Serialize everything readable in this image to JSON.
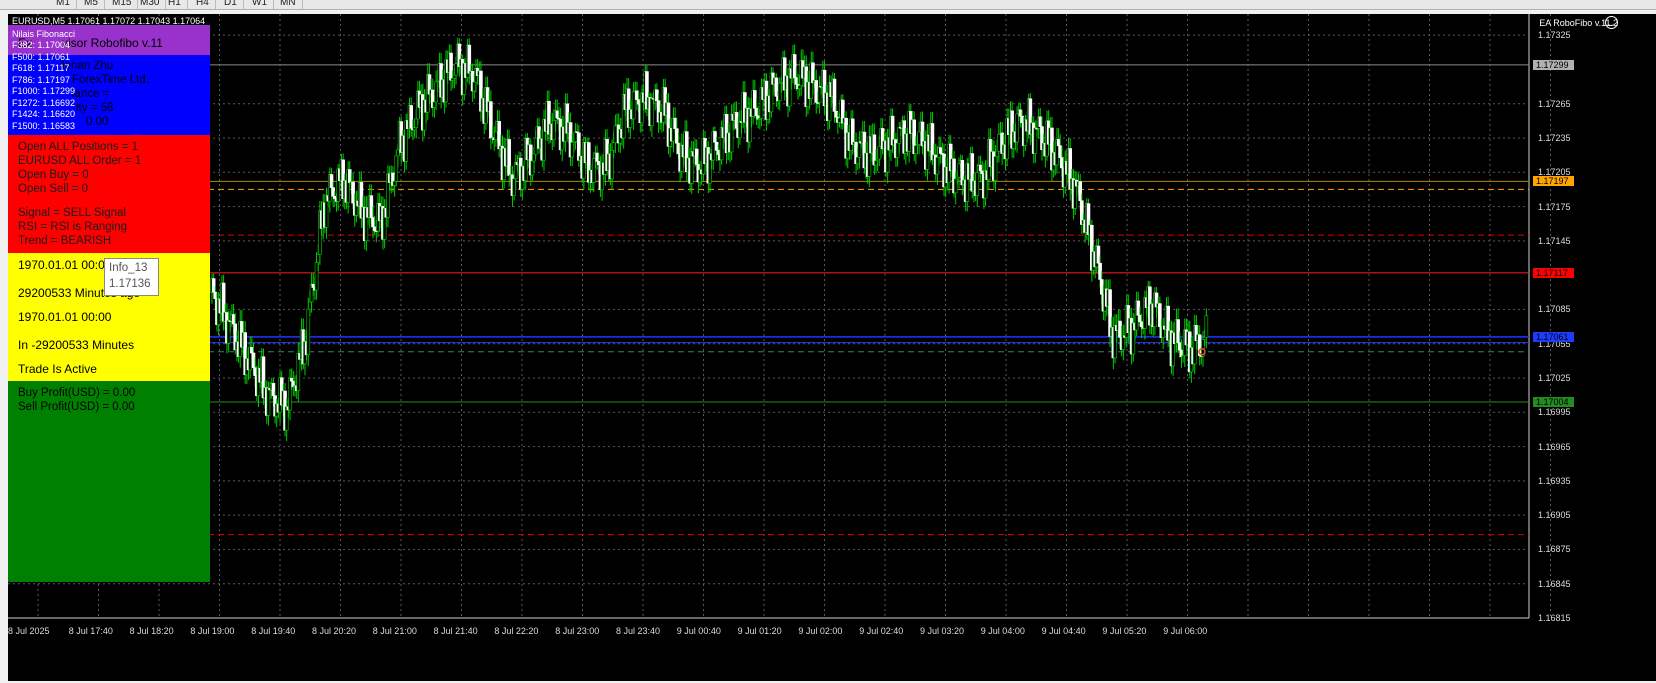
{
  "toolbar": {
    "timeframes": [
      "M1",
      "M5",
      "M15",
      "M30",
      "H1",
      "H4",
      "D1",
      "W1",
      "MN"
    ]
  },
  "chart": {
    "symbol_header": "EURUSD,M5  1.17061 1.17072 1.17043 1.17064",
    "ea_label": "EA RoboFibo v.11.2",
    "price_labels": [
      "1.17325",
      "1.17265",
      "1.17235",
      "1.17205",
      "1.17175",
      "1.17145",
      "1.17085",
      "1.17055",
      "1.17025",
      "1.16995",
      "1.16965",
      "1.16935",
      "1.16905",
      "1.16875",
      "1.16845",
      "1.16815"
    ],
    "price_tags": [
      {
        "text": "1.17299",
        "color": "#b0b0b0"
      },
      {
        "text": "1.17197",
        "color": "#ffa500"
      },
      {
        "text": "1.17117",
        "color": "#ff0000"
      },
      {
        "text": "1.17061",
        "color": "#1e3cff"
      },
      {
        "text": "1.17004",
        "color": "#228b22"
      }
    ],
    "time_labels": [
      "8 Jul 2025",
      "8 Jul 17:40",
      "8 Jul 18:20",
      "8 Jul 19:00",
      "8 Jul 19:40",
      "8 Jul 20:20",
      "8 Jul 21:00",
      "8 Jul 21:40",
      "8 Jul 22:20",
      "8 Jul 23:00",
      "8 Jul 23:40",
      "9 Jul 00:40",
      "9 Jul 01:20",
      "9 Jul 02:00",
      "9 Jul 02:40",
      "9 Jul 03:20",
      "9 Jul 04:00",
      "9 Jul 04:40",
      "9 Jul 05:20",
      "9 Jul 06:00"
    ]
  },
  "panel": {
    "purple": {
      "title_left": "Ex",
      "title_right": "visor Robofibo v.11",
      "fib_header": "Nilais Fibonacci"
    },
    "fib": [
      "F382: 1.17004",
      "F500: 1.17061",
      "F618: 1.17117",
      "F786: 1.17197",
      "F1000: 1.17299",
      "F1272: 1.16692",
      "F1424: 1.16620",
      "F1500: 1.16583"
    ],
    "blue": {
      "line1": "lenan Zhu",
      "line2": "ForexTime Ltd.",
      "line3": "lance = ",
      "line4": "ity = 58",
      "line5": "0.00"
    },
    "red": {
      "open_all": "Open ALL Positions = 1",
      "eurusd_all": "EURUSD ALL Order = 1",
      "open_buy": "Open Buy  = 0",
      "open_sell": "Open Sell = 0",
      "signal": "Signal  = SELL Signal",
      "rsi": "RSI = RSI is Ranging",
      "trend": "Trend = BEARISH"
    },
    "yellow": {
      "date1": "1970.01.01 00:0",
      "ago": "29200533 Minutes ago",
      "date2": "1970.01.01 00:00",
      "in_minutes": "In -29200533 Minutes",
      "trade": "Trade Is Active"
    },
    "green": {
      "buy_profit": "Buy Profit(USD) = 0.00",
      "sell_profit": "Sell Profit(USD) = 0.00"
    }
  },
  "tooltip": {
    "name": "Info_13",
    "value": "1.17136"
  }
}
